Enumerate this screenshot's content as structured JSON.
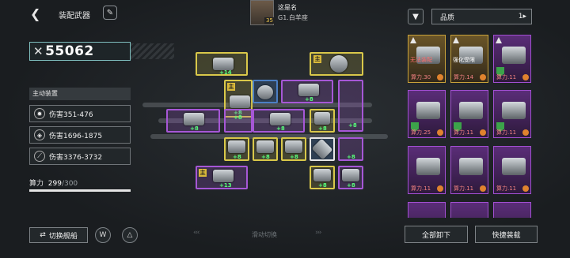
{
  "header": {
    "title": "装配武器",
    "back_icon": "back-arrow-icon",
    "brush_icon": "brush-icon"
  },
  "player": {
    "name": "这是名",
    "guild": "G1.白羊座",
    "level": "35"
  },
  "power": {
    "value": "55062",
    "icon": "crossed-swords-icon"
  },
  "skills": {
    "label": "主动装置",
    "items": [
      {
        "text": "伤害351-476",
        "icon": "burst-icon"
      },
      {
        "text": "伤害1696-1875",
        "icon": "shield-icon"
      },
      {
        "text": "伤害3376-3732",
        "icon": "claw-icon"
      }
    ]
  },
  "capacity": {
    "label": "算力",
    "used": "299",
    "max": "/300",
    "fraction": 0.997
  },
  "bottom": {
    "switch_ship": "切换舰船",
    "slide_hint": "滑动切换"
  },
  "grid": {
    "tags": {
      "main": "主"
    },
    "plus": [
      "+14",
      "+8",
      "+8",
      "+8",
      "+8",
      "+8",
      "+8",
      "+8",
      "+8",
      "+8",
      "+8",
      "+8",
      "+8",
      "+13",
      "+8",
      "+8"
    ]
  },
  "filter": {
    "quality_label": "品质",
    "filter_icon": "funnel-icon",
    "sort_icon": "sort-icon"
  },
  "inventory": {
    "cards": [
      {
        "cost": "算力.30",
        "warn": "无法装配",
        "rarity": "gold",
        "warn_color": "red"
      },
      {
        "cost": "算力.14",
        "warn": "强化受限",
        "rarity": "gold",
        "warn_color": "white"
      },
      {
        "cost": "算力.11",
        "rarity": "purple"
      },
      {
        "cost": "算力.25",
        "rarity": "purple"
      },
      {
        "cost": "算力.11",
        "rarity": "purple"
      },
      {
        "cost": "算力.11",
        "rarity": "purple"
      },
      {
        "cost": "算力.11",
        "rarity": "purple"
      },
      {
        "cost": "算力.11",
        "rarity": "purple"
      },
      {
        "cost": "算力.11",
        "rarity": "purple"
      }
    ]
  },
  "actions": {
    "unload_all": "全部卸下",
    "quick_equip": "快捷装载"
  },
  "colors": {
    "gold_border": "#d9c84a",
    "purple_border": "#a657d6",
    "plus_green": "#58ff7a",
    "background": "#1c1f22"
  }
}
